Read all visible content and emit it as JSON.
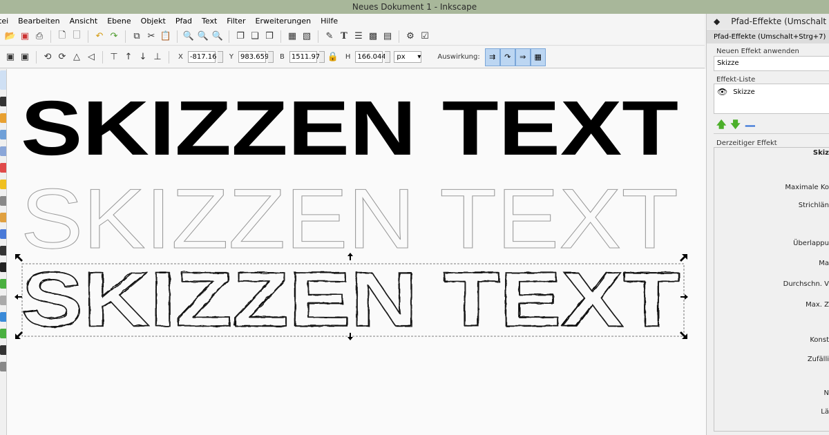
{
  "window": {
    "title": "Neues Dokument 1 - Inkscape"
  },
  "menu": [
    "tei",
    "Bearbeiten",
    "Ansicht",
    "Ebene",
    "Objekt",
    "Pfad",
    "Text",
    "Filter",
    "Erweiterungen",
    "Hilfe"
  ],
  "controls": {
    "x_label": "X",
    "x_value": "-817.16",
    "y_label": "Y",
    "y_value": "983.659",
    "w_label": "B",
    "w_value": "1511.97",
    "h_label": "H",
    "h_value": "166.044",
    "unit": "px",
    "effect_label": "Auswirkung:"
  },
  "canvas": {
    "text": "SKIZZEN TEXT"
  },
  "panel": {
    "title": "Pfad-Effekte (Umschalt",
    "subtitle": "Pfad-Effekte (Umschalt+Strg+7)",
    "new_effect_label": "Neuen Effekt anwenden",
    "new_effect_value": "Skizze",
    "list_label": "Effekt-Liste",
    "list_item": "Skizze",
    "current_label": "Derzeitiger Effekt",
    "current_name": "Skiz",
    "params": [
      "Maximale Ko",
      "Strichlän",
      "Überlappu",
      "Ma",
      "Durchschn. V",
      "Max. Z",
      "Konst",
      "Zufälli",
      "N",
      "Lä"
    ]
  },
  "colors": {
    "titlebar": "#a8b79a",
    "accent": "#bcd6f2",
    "arrow_green": "#4caf2a",
    "minus_blue": "#2a6bd6"
  }
}
